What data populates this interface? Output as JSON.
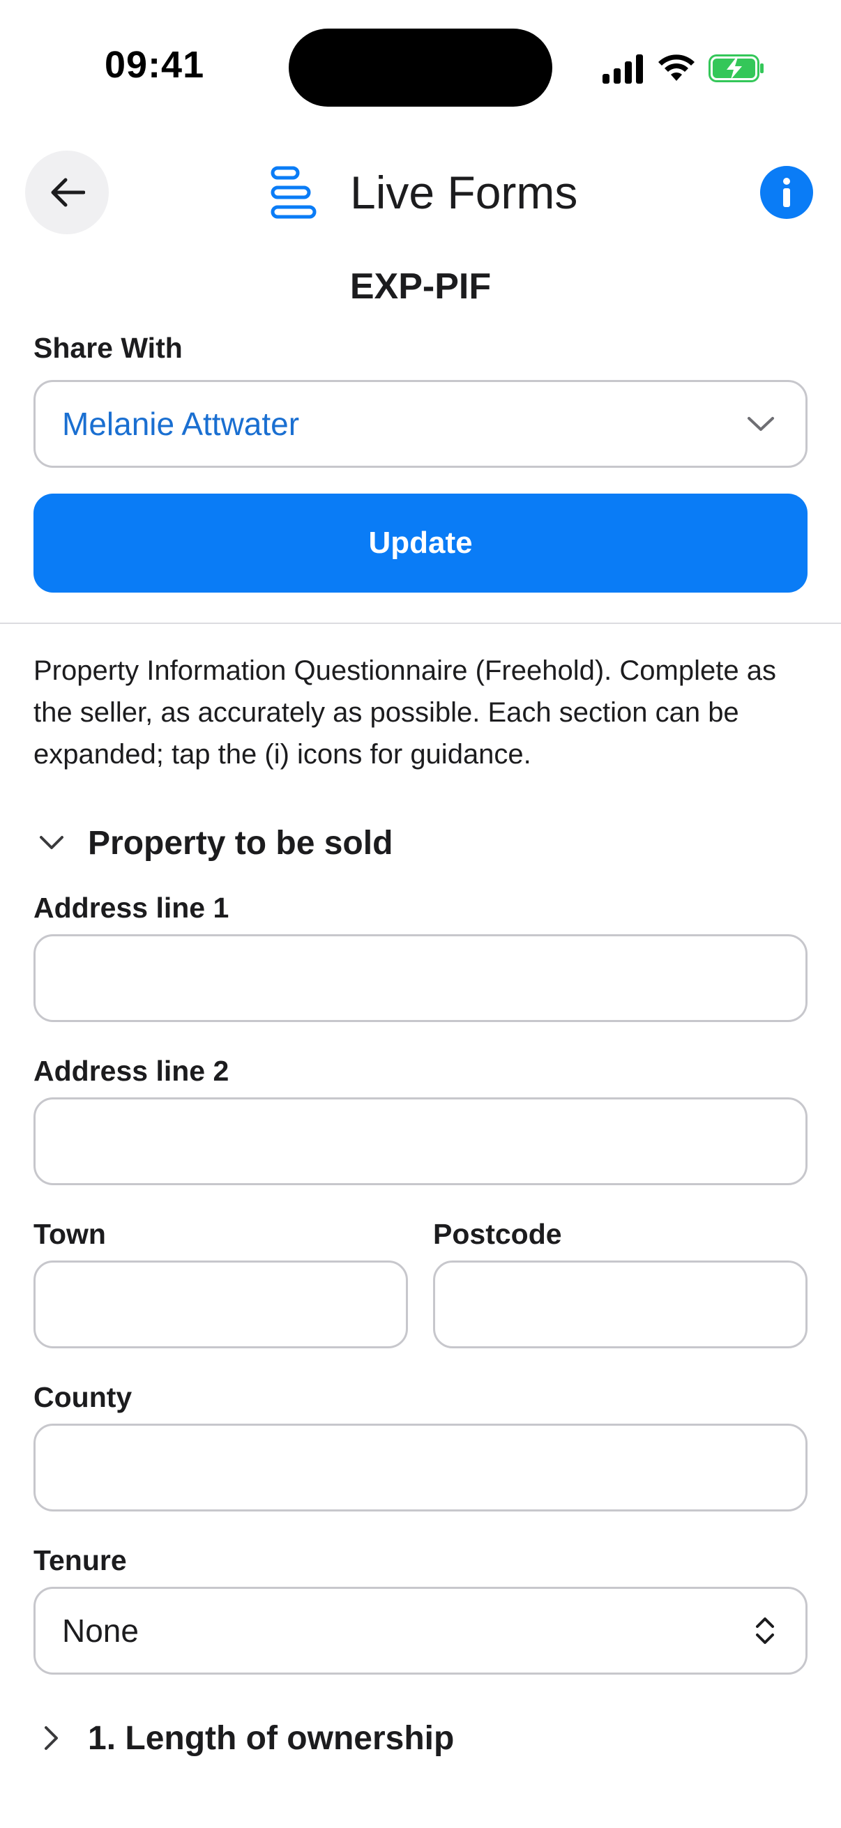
{
  "status_bar": {
    "time": "09:41"
  },
  "header": {
    "app_title": "Live Forms",
    "form_code": "EXP-PIF"
  },
  "share": {
    "label": "Share With",
    "selected": "Melanie Attwater",
    "update_label": "Update"
  },
  "description": "Property Information Questionnaire (Freehold). Complete as the seller, as accurately as possible. Each section can be expanded; tap the (i) icons for guidance.",
  "section_property": {
    "title": "Property to be sold",
    "expanded": true,
    "fields": {
      "address1_label": "Address line 1",
      "address1_value": "",
      "address2_label": "Address line 2",
      "address2_value": "",
      "town_label": "Town",
      "town_value": "",
      "postcode_label": "Postcode",
      "postcode_value": "",
      "county_label": "County",
      "county_value": "",
      "tenure_label": "Tenure",
      "tenure_value": "None"
    }
  },
  "section_ownership": {
    "title": "1. Length of ownership",
    "expanded": false
  },
  "colors": {
    "accent": "#0a7cf6",
    "selected_text": "#1a6fd1",
    "border": "#c7c7cc",
    "battery": "#34c759"
  }
}
